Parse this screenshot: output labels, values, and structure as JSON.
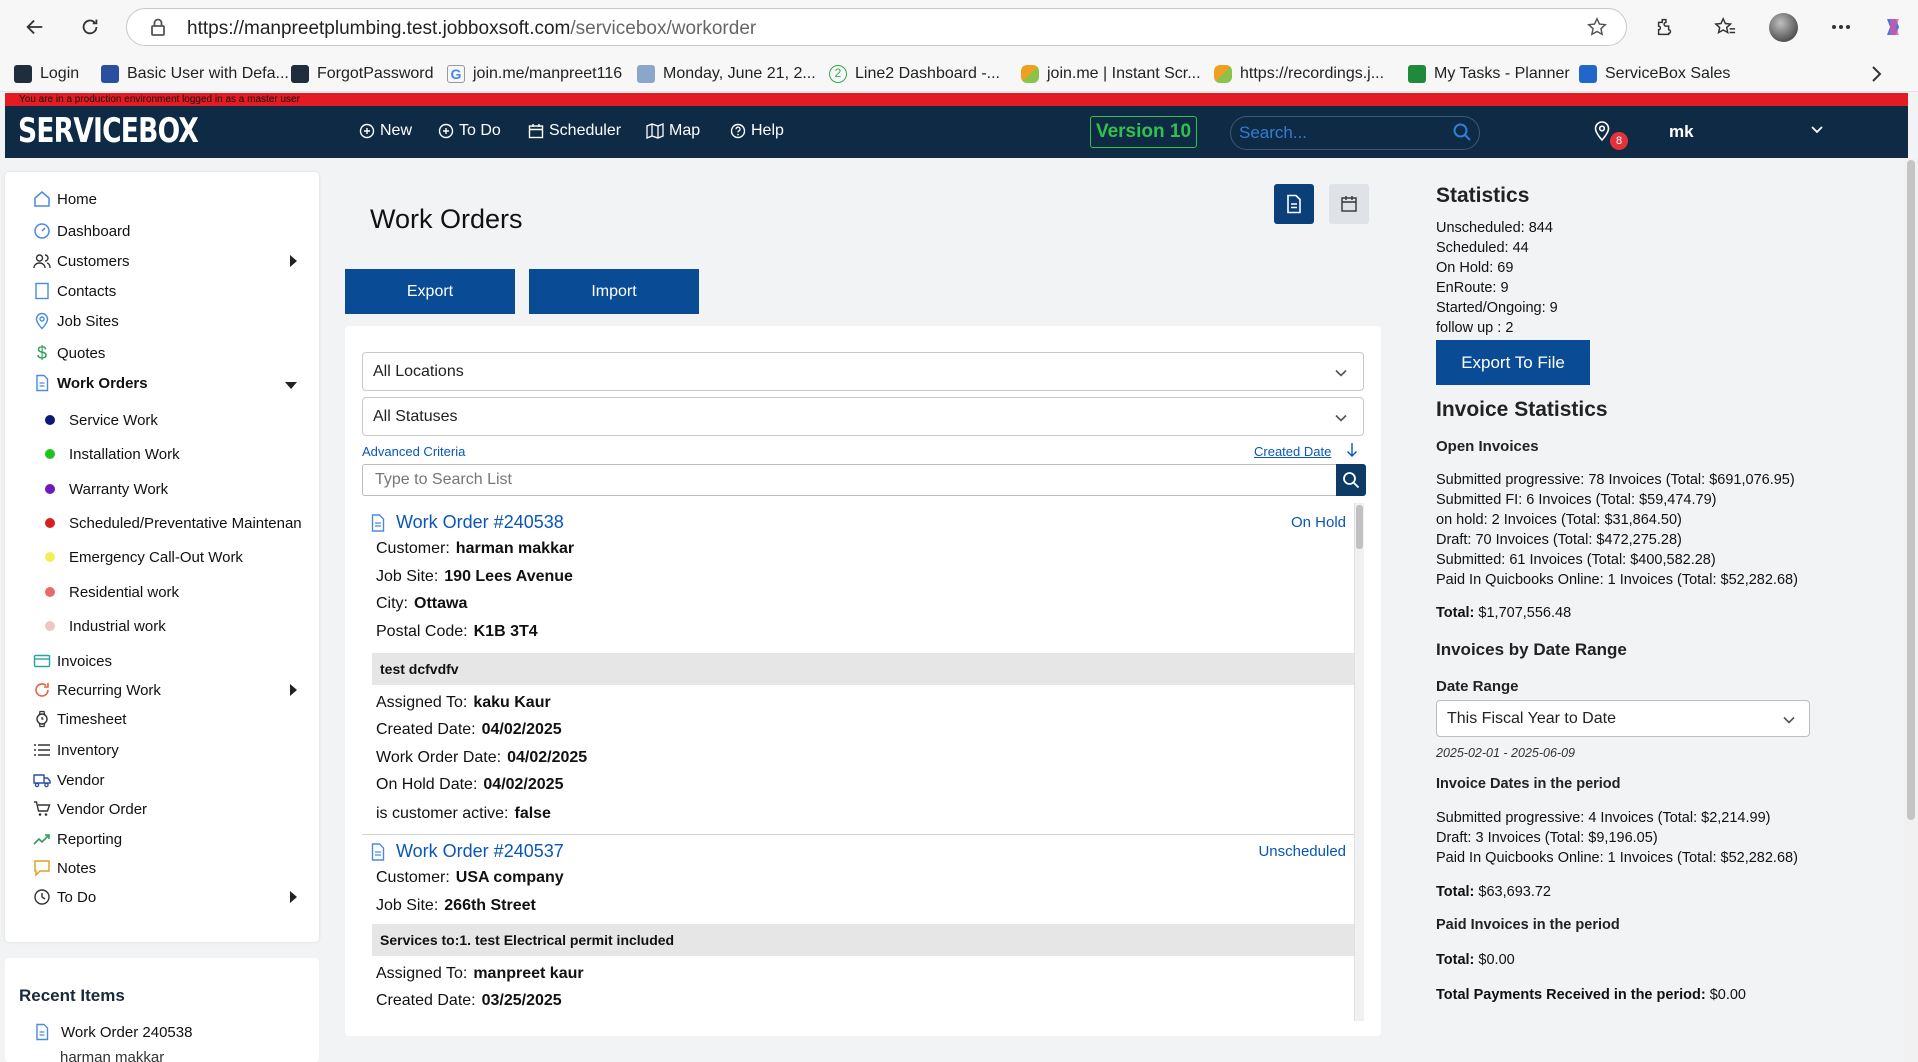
{
  "browser": {
    "url_host": "https://manpreetplumbing.test.jobboxsoft.com",
    "url_path": "/servicebox/workorder",
    "bookmarks": [
      {
        "label": "Login",
        "color": "#1f2d3d"
      },
      {
        "label": "Basic User with Defa...",
        "color": "#2a4fa0"
      },
      {
        "label": "ForgotPassword",
        "color": "#1f2d3d"
      },
      {
        "label": "join.me/manpreet116",
        "color": "#ffffff"
      },
      {
        "label": "Monday, June 21, 2...",
        "color": "#8aa7c9"
      },
      {
        "label": "Line2 Dashboard -...",
        "color": "#ffffff"
      },
      {
        "label": "join.me | Instant Scr...",
        "color": "#f0a020"
      },
      {
        "label": "https://recordings.j...",
        "color": "#f0a020"
      },
      {
        "label": "My Tasks - Planner",
        "color": "#1f8a3a"
      },
      {
        "label": "ServiceBox Sales",
        "color": "#2266cc"
      }
    ]
  },
  "env_notice": "You are in a production environment logged in as a master user",
  "header": {
    "logo": "SERVICEBOX",
    "nav": [
      "New",
      "To Do",
      "Scheduler",
      "Map",
      "Help"
    ],
    "version": "Version 10",
    "search_placeholder": "Search...",
    "notification_count": "8",
    "user": "mk"
  },
  "sidebar": {
    "items": [
      "Home",
      "Dashboard",
      "Customers",
      "Contacts",
      "Job Sites",
      "Quotes",
      "Work Orders"
    ],
    "work_order_types": [
      {
        "label": "Service Work",
        "color": "#0b1a7a"
      },
      {
        "label": "Installation Work",
        "color": "#22c31f"
      },
      {
        "label": "Warranty Work",
        "color": "#6a1bb8"
      },
      {
        "label": "Scheduled/Preventative Maintenan",
        "color": "#d92020"
      },
      {
        "label": "Emergency Call-Out Work",
        "color": "#f2ee5a"
      },
      {
        "label": "Residential work",
        "color": "#ea6a6a"
      },
      {
        "label": "Industrial work",
        "color": "#f2c4c4"
      }
    ],
    "items_after": [
      "Invoices",
      "Recurring Work",
      "Timesheet",
      "Inventory",
      "Vendor",
      "Vendor Order",
      "Reporting",
      "Notes",
      "To Do"
    ]
  },
  "recent": {
    "title": "Recent Items",
    "item": "Work Order 240538",
    "sub": "harman makkar"
  },
  "main": {
    "title": "Work Orders",
    "export_label": "Export",
    "import_label": "Import",
    "location_filter": "All Locations",
    "status_filter": "All Statuses",
    "advanced_criteria": "Advanced Criteria",
    "sort_label": "Created Date",
    "search_placeholder": "Type to Search List"
  },
  "work_orders": [
    {
      "title": "Work Order #240538",
      "status": "On Hold",
      "customer": "harman makkar",
      "job_site": "190 Lees Avenue",
      "city": "Ottawa",
      "postal_code": "K1B 3T4",
      "description": "test dcfvdfv",
      "assigned_to": "kaku Kaur",
      "created_date": "04/02/2025",
      "work_order_date": "04/02/2025",
      "on_hold_date": "04/02/2025",
      "customer_active": "false"
    },
    {
      "title": "Work Order #240537",
      "status": "Unscheduled",
      "customer": "USA company",
      "job_site": "266th Street",
      "description": "Services to:1. test Electrical permit included",
      "assigned_to": "manpreet kaur",
      "created_date": "03/25/2025"
    }
  ],
  "labels": {
    "customer": "Customer:",
    "job_site": "Job Site:",
    "city": "City:",
    "postal_code": "Postal Code:",
    "assigned_to": "Assigned To:",
    "created_date": "Created Date:",
    "work_order_date": "Work Order Date:",
    "on_hold_date": "On Hold Date:",
    "customer_active": "is customer active:"
  },
  "statistics": {
    "title": "Statistics",
    "lines": [
      "Unscheduled: 844",
      "Scheduled: 44",
      "On Hold: 69",
      "EnRoute: 9",
      "Started/Ongoing: 9",
      "follow up : 2"
    ],
    "export_label": "Export To File",
    "invoice_title": "Invoice Statistics",
    "open_invoices_title": "Open Invoices",
    "open_invoices": [
      "Submitted progressive: 78 Invoices (Total: $691,076.95)",
      "Submitted FI: 6 Invoices (Total: $59,474.79)",
      "on hold: 2 Invoices (Total: $31,864.50)",
      "Draft: 70 Invoices (Total: $472,275.28)",
      "Submitted: 61 Invoices (Total: $400,582.28)",
      "Paid In Quicbooks Online: 1 Invoices (Total: $52,282.68)"
    ],
    "open_total_label": "Total:",
    "open_total": "$1,707,556.48",
    "by_date_title": "Invoices by Date Range",
    "date_range_label": "Date Range",
    "date_range_selected": "This Fiscal Year to Date",
    "date_range_value": "2025-02-01 - 2025-06-09",
    "period_title": "Invoice Dates in the period",
    "period_lines": [
      "Submitted progressive: 4 Invoices (Total: $2,214.99)",
      "Draft: 3 Invoices (Total: $9,196.05)",
      "Paid In Quicbooks Online: 1 Invoices (Total: $52,282.68)"
    ],
    "period_total_label": "Total:",
    "period_total": "$63,693.72",
    "paid_title": "Paid Invoices in the period",
    "paid_total_label": "Total:",
    "paid_total": "$0.00",
    "payments_label": "Total Payments Received in the period:",
    "payments_value": "$0.00"
  }
}
